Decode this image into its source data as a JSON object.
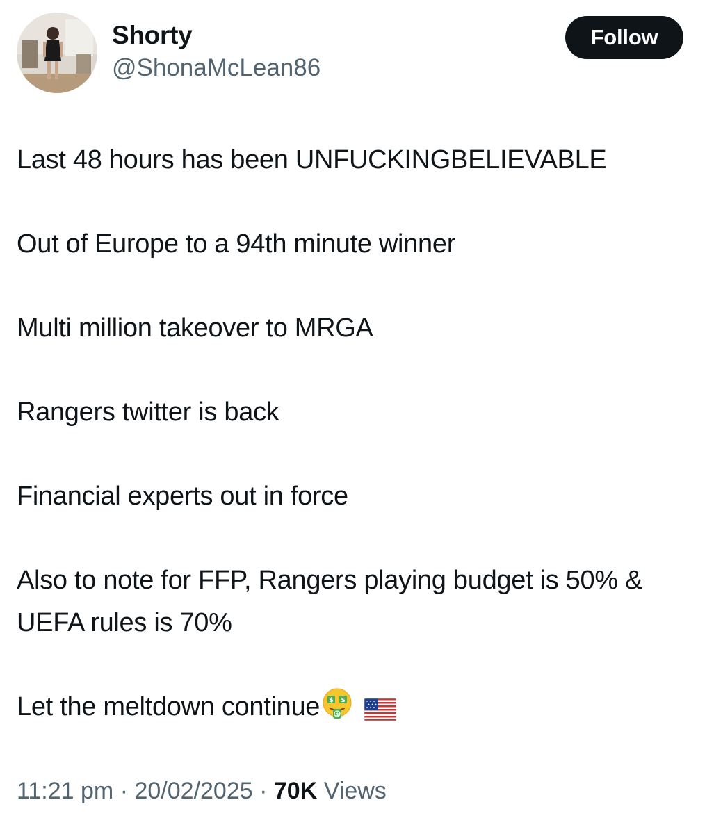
{
  "author": {
    "display_name": "Shorty",
    "handle": "@ShonaMcLean86",
    "avatar_icon": "profile-photo"
  },
  "follow_button": {
    "label": "Follow"
  },
  "tweet": {
    "paragraphs": [
      "Last 48 hours has been UNFUCKINGBELIEVABLE",
      "Out of Europe to a 94th minute winner",
      "Multi million takeover to MRGA",
      "Rangers twitter is back",
      "Financial experts out in force",
      "Also to note for FFP, Rangers playing budget is 50% & UEFA rules is 70%"
    ],
    "last_line_text": "Let the meltdown continue",
    "last_line_emojis": [
      "money-mouth-face-icon",
      "us-flag-icon"
    ]
  },
  "meta": {
    "time": "11:21 pm",
    "separator": "·",
    "date": "20/02/2025",
    "views_count": "70K",
    "views_label": "Views"
  },
  "colors": {
    "text_primary": "#0f1419",
    "text_secondary": "#536471",
    "button_bg": "#0f1419",
    "button_text": "#ffffff"
  }
}
